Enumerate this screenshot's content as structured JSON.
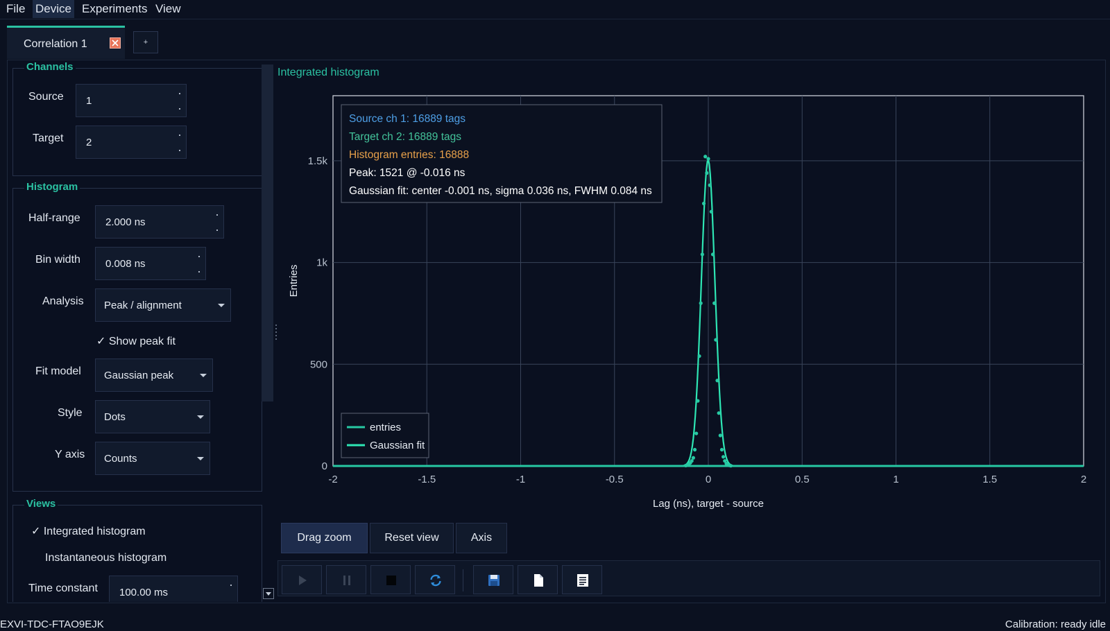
{
  "menu": {
    "items": [
      "File",
      "Device",
      "Experiments",
      "View"
    ]
  },
  "tabs": {
    "active_label": "Correlation 1",
    "add_label": "+"
  },
  "channels": {
    "title": "Channels",
    "source_label": "Source",
    "source_value": "1",
    "target_label": "Target",
    "target_value": "2"
  },
  "histogram": {
    "title": "Histogram",
    "half_range_label": "Half-range",
    "half_range_value": "2.000 ns",
    "bin_width_label": "Bin width",
    "bin_width_value": "0.008 ns",
    "analysis_label": "Analysis",
    "analysis_value": "Peak / alignment",
    "show_peak_fit_label": "Show peak fit",
    "show_peak_fit_checked": true,
    "fit_model_label": "Fit model",
    "fit_model_value": "Gaussian peak",
    "style_label": "Style",
    "style_value": "Dots",
    "y_axis_label": "Y axis",
    "y_axis_value": "Counts"
  },
  "views": {
    "title": "Views",
    "integrated_label": "Integrated histogram",
    "integrated_checked": true,
    "instantaneous_label": "Instantaneous histogram",
    "instantaneous_checked": false,
    "time_constant_label": "Time constant",
    "time_constant_value": "100.00 ms"
  },
  "chart": {
    "title": "Integrated histogram",
    "info": {
      "source": "Source ch 1: 16889 tags",
      "target": "Target ch 2: 16889 tags",
      "entries": "Histogram entries: 16888",
      "peak": "Peak: 1521 @ -0.016 ns",
      "fit": "Gaussian fit: center -0.001 ns, sigma 0.036 ns, FWHM 0.084 ns"
    },
    "legend": [
      "entries",
      "Gaussian fit"
    ],
    "buttons": {
      "drag_zoom": "Drag zoom",
      "reset_view": "Reset view",
      "axis": "Axis"
    }
  },
  "toolbar": {
    "icons": [
      "play-icon",
      "pause-icon",
      "stop-icon",
      "refresh-icon",
      "save-icon",
      "new-file-icon",
      "notes-icon"
    ]
  },
  "status": {
    "device": "EXVI-TDC-FTAO9EJK",
    "right": "Calibration: ready  idle"
  },
  "colors": {
    "accent": "#2bc1a2",
    "series": "#2ee6b4",
    "info_source": "#4e9fe6",
    "info_target": "#43c39a",
    "info_entries": "#e8a14a",
    "background": "#0b1120"
  },
  "chart_data": {
    "type": "scatter",
    "xlabel": "Lag (ns), target - source",
    "ylabel": "Entries",
    "xlim": [
      -2,
      2
    ],
    "ylim": [
      0,
      1820
    ],
    "xticks": [
      -2,
      -1.5,
      -1,
      -0.5,
      0,
      0.5,
      1,
      1.5,
      2
    ],
    "xtick_labels": [
      "-2",
      "-1.5",
      "-1",
      "-0.5",
      "0",
      "0.5",
      "1",
      "1.5",
      "2"
    ],
    "yticks": [
      0,
      500,
      1000,
      1500
    ],
    "ytick_labels": [
      "0",
      "500",
      "1k",
      "1.5k"
    ],
    "grid": true,
    "legend_position": "bottom-left",
    "series": [
      {
        "name": "entries",
        "style": "dots",
        "x": [
          -0.12,
          -0.112,
          -0.104,
          -0.096,
          -0.088,
          -0.08,
          -0.072,
          -0.064,
          -0.056,
          -0.048,
          -0.04,
          -0.032,
          -0.024,
          -0.016,
          -0.008,
          0,
          0.008,
          0.016,
          0.024,
          0.032,
          0.04,
          0.048,
          0.056,
          0.064,
          0.072,
          0.08,
          0.088,
          0.096,
          0.104,
          0.112,
          0.12
        ],
        "y": [
          2,
          4,
          8,
          15,
          25,
          40,
          80,
          160,
          320,
          540,
          800,
          1040,
          1290,
          1521,
          1440,
          1510,
          1380,
          1250,
          1040,
          800,
          620,
          420,
          260,
          150,
          80,
          45,
          25,
          12,
          6,
          3,
          1
        ]
      },
      {
        "name": "Gaussian fit",
        "style": "line",
        "model": "gaussian",
        "center": -0.001,
        "sigma": 0.036,
        "amplitude": 1505
      }
    ]
  }
}
